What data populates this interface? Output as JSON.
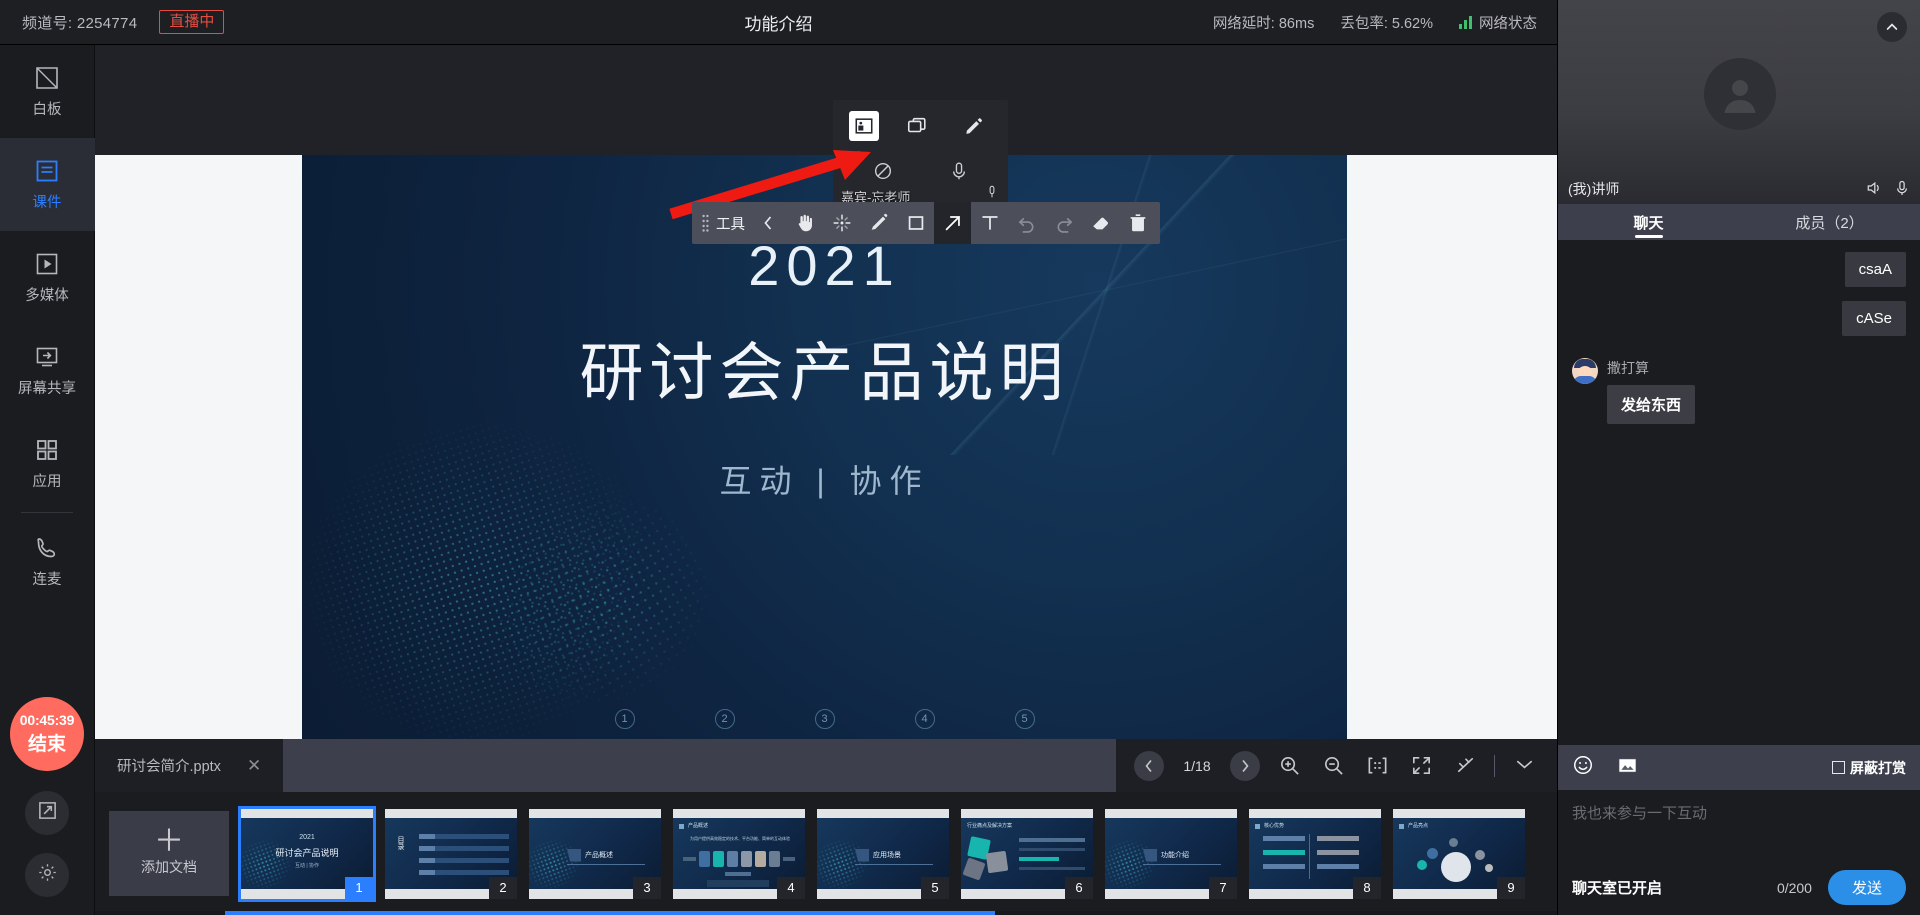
{
  "topbar": {
    "channel_label": "频道号: 2254774",
    "live_badge": "直播中",
    "title": "功能介绍",
    "latency": "网络延时: 86ms",
    "packet_loss": "丢包率: 5.62%",
    "net_status": "网络状态"
  },
  "sidebar": {
    "items": [
      {
        "label": "白板",
        "icon": "whiteboard-icon"
      },
      {
        "label": "课件",
        "icon": "courseware-icon"
      },
      {
        "label": "多媒体",
        "icon": "multimedia-icon"
      },
      {
        "label": "屏幕共享",
        "icon": "screen-share-icon"
      },
      {
        "label": "应用",
        "icon": "apps-icon"
      },
      {
        "label": "连麦",
        "icon": "phone-icon"
      }
    ],
    "active_index": 1,
    "end_button": {
      "timer": "00:45:39",
      "label": "结束"
    },
    "popout_icon": "popout-icon",
    "settings_icon": "gear-icon"
  },
  "presenter_card": {
    "name": "嘉宾-忘老师",
    "buttons": [
      "pip-icon",
      "window-icon",
      "pencil-icon",
      "camera-off-icon",
      "mic-icon"
    ],
    "selected_index": 0
  },
  "draw_toolbar": {
    "grip": "drag-grip-icon",
    "label": "工具",
    "collapse": "chevron-left-icon",
    "tools": [
      {
        "name": "hand-tool",
        "glyph": "hand"
      },
      {
        "name": "select-tool",
        "glyph": "select"
      },
      {
        "name": "pen-tool",
        "glyph": "pen"
      },
      {
        "name": "rect-tool",
        "glyph": "rect"
      },
      {
        "name": "arrow-tool",
        "glyph": "arrow"
      },
      {
        "name": "text-tool",
        "glyph": "text"
      },
      {
        "name": "undo-tool",
        "glyph": "undo"
      },
      {
        "name": "redo-tool",
        "glyph": "redo"
      },
      {
        "name": "eraser-tool",
        "glyph": "eraser"
      },
      {
        "name": "delete-tool",
        "glyph": "trash"
      }
    ],
    "active_tool": "arrow-tool"
  },
  "slide": {
    "year": "2021",
    "title": "研讨会产品说明",
    "subtitle": "互动 | 协作",
    "page_markers": [
      "1",
      "2",
      "3",
      "4",
      "5"
    ]
  },
  "docbar": {
    "file_name": "研讨会简介.pptx",
    "close_icon": "close-icon",
    "prev_icon": "chevron-left-icon",
    "next_icon": "chevron-right-icon",
    "page_indicator": "1/18",
    "zoom_in_icon": "zoom-in-icon",
    "zoom_out_icon": "zoom-out-icon",
    "fit_width_icon": "fit-width-icon",
    "fullscreen_icon": "fullscreen-icon",
    "laser_icon": "laser-pointer-icon",
    "collapse_icon": "chevron-double-down-icon"
  },
  "thumbs": {
    "add_label": "添加文档",
    "add_icon": "plus-icon",
    "selected": 1,
    "slides": [
      {
        "num": "1",
        "kind": "cover",
        "line1": "2021",
        "line2": "研讨会产品说明",
        "line3": "互动 | 协作"
      },
      {
        "num": "2",
        "kind": "toc",
        "label": "目录",
        "items": [
          "产品集成",
          "直播场景",
          "功能介绍",
          "产品亮点"
        ]
      },
      {
        "num": "3",
        "kind": "section",
        "label": "产品概述"
      },
      {
        "num": "4",
        "kind": "content-icons",
        "header": "产品概述",
        "caption": "为用户提供高效稳定的技术、平台功能、简单的互动体验"
      },
      {
        "num": "5",
        "kind": "section",
        "label": "应用场景"
      },
      {
        "num": "6",
        "kind": "puzzle",
        "header": "行业痛点及解决方案"
      },
      {
        "num": "7",
        "kind": "section",
        "label": "功能介绍"
      },
      {
        "num": "8",
        "kind": "two-column",
        "header": "核心优势"
      },
      {
        "num": "9",
        "kind": "globe",
        "header": "产品亮点"
      }
    ]
  },
  "right_panel": {
    "video": {
      "name": "(我)讲师",
      "collapse_icon": "chevron-up-icon",
      "speaker_icon": "speaker-icon",
      "mic_icon": "mic-icon",
      "avatar_icon": "user-avatar-icon"
    },
    "tabs": [
      {
        "label": "聊天",
        "active": true
      },
      {
        "label": "成员（2）",
        "active": false
      }
    ],
    "messages": [
      {
        "side": "right",
        "text": "csaA"
      },
      {
        "side": "right",
        "text": "cASe"
      },
      {
        "side": "left",
        "sender": "撒打算",
        "text": "发给东西"
      }
    ],
    "compose": {
      "emoji_icon": "emoji-icon",
      "image_icon": "image-icon",
      "shield_label": "屏蔽打赏",
      "placeholder": "我也来参与一下互动",
      "room_status": "聊天室已开启",
      "counter": "0/200",
      "send_label": "发送"
    }
  },
  "colors": {
    "accent_blue": "#2b7fff",
    "live_red": "#e54d42",
    "end_red": "#ff6b5e",
    "send_blue": "#2b8fe8",
    "net_green": "#3ec16a"
  }
}
